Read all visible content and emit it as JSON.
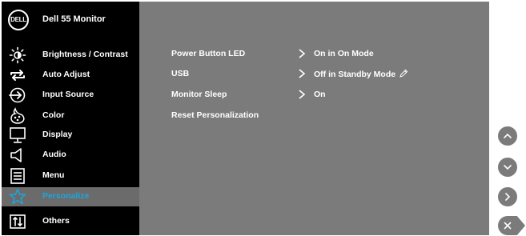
{
  "header": {
    "logo_text": "DELL",
    "title": "Dell 55 Monitor"
  },
  "menu": {
    "items": [
      {
        "label": "Brightness / Contrast",
        "icon": "brightness-icon"
      },
      {
        "label": "Auto Adjust",
        "icon": "auto-adjust-icon"
      },
      {
        "label": "Input Source",
        "icon": "input-source-icon"
      },
      {
        "label": "Color",
        "icon": "color-icon"
      },
      {
        "label": "Display",
        "icon": "display-icon"
      },
      {
        "label": "Audio",
        "icon": "audio-icon"
      },
      {
        "label": "Menu",
        "icon": "menu-icon"
      },
      {
        "label": "Personalize",
        "icon": "star-icon",
        "selected": true
      },
      {
        "label": "Others",
        "icon": "others-icon"
      }
    ]
  },
  "settings": {
    "rows": [
      {
        "label": "Power Button LED",
        "value": "On in On Mode"
      },
      {
        "label": "USB",
        "value": "Off in Standby Mode"
      },
      {
        "label": "Monitor Sleep",
        "value": "On"
      },
      {
        "label": "Reset Personalization",
        "value": ""
      }
    ]
  },
  "nav": [
    "up-icon",
    "down-icon",
    "right-icon",
    "exit-icon"
  ],
  "colors": {
    "left_bg": "#000000",
    "right_bg": "#7b7b7b",
    "selected_bg": "#6b6b6b",
    "accent": "#1aa7e0",
    "text": "#ffffff"
  }
}
